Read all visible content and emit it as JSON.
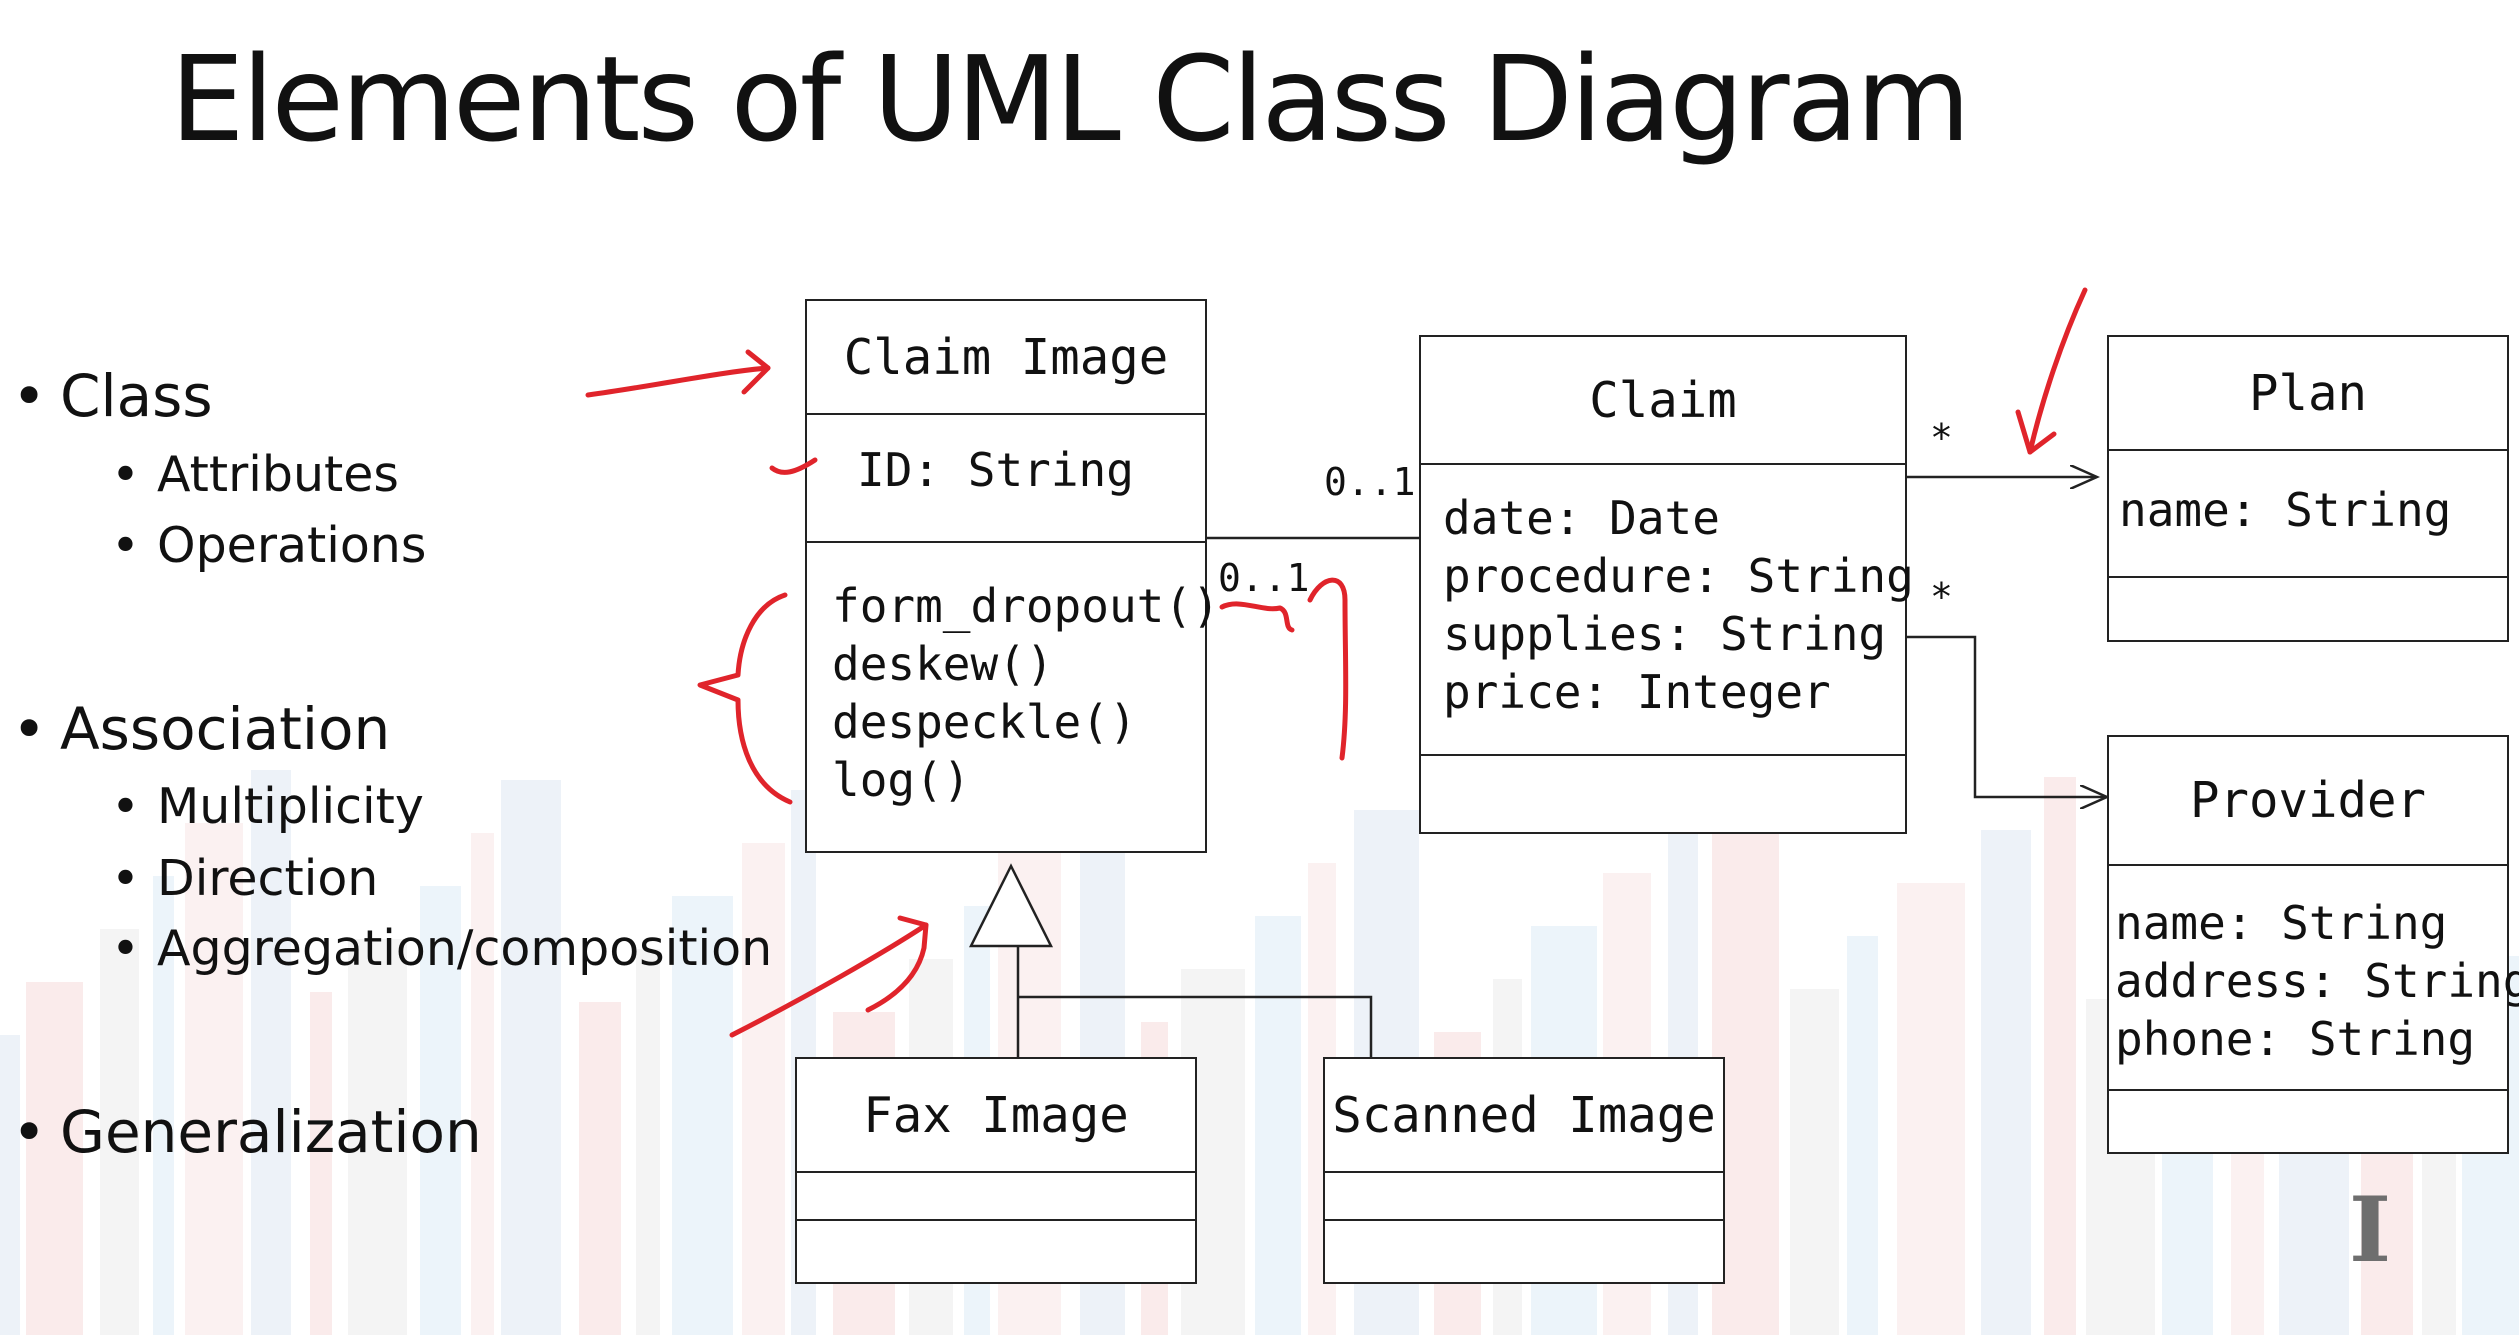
{
  "slide": {
    "title": "Elements of UML Class Diagram",
    "bullets": [
      {
        "text": "Class",
        "sub": [
          "Attributes",
          "Operations"
        ]
      },
      {
        "text": "Association",
        "sub": [
          "Multiplicity",
          "Direction",
          "Aggregation/composition"
        ]
      },
      {
        "text": "Generalization",
        "sub": []
      }
    ]
  },
  "diagram": {
    "classes": {
      "claim_image": {
        "name": "Claim Image",
        "attributes": [
          "ID: String"
        ],
        "operations": [
          "form_dropout()",
          "deskew()",
          "despeckle()",
          "log()"
        ]
      },
      "claim": {
        "name": "Claim",
        "attributes": [
          "date: Date",
          "procedure: String",
          "supplies: String",
          "price: Integer"
        ],
        "operations": []
      },
      "plan": {
        "name": "Plan",
        "attributes": [
          "name: String"
        ],
        "operations": []
      },
      "provider": {
        "name": "Provider",
        "attributes": [
          "name: String",
          "address: String",
          "phone: String"
        ],
        "operations": []
      },
      "fax_image": {
        "name": "Fax Image",
        "attributes": [],
        "operations": []
      },
      "scanned_image": {
        "name": "Scanned Image",
        "attributes": [],
        "operations": []
      }
    },
    "multiplicities": {
      "claim_end": "0..1",
      "claim_image_end": "0..1",
      "plan_end": "*",
      "provider_end": "*"
    }
  },
  "colors": {
    "annotation": "#e0242b",
    "stripe_palette": [
      "#d7e3ef",
      "#f3d3d3",
      "#e6e6e6",
      "#d4e6f4",
      "#f6e0e0"
    ],
    "watermark": "#6e6e6e"
  },
  "watermark": {
    "glyph": "I",
    "icon": "illinois-block-i-icon"
  }
}
